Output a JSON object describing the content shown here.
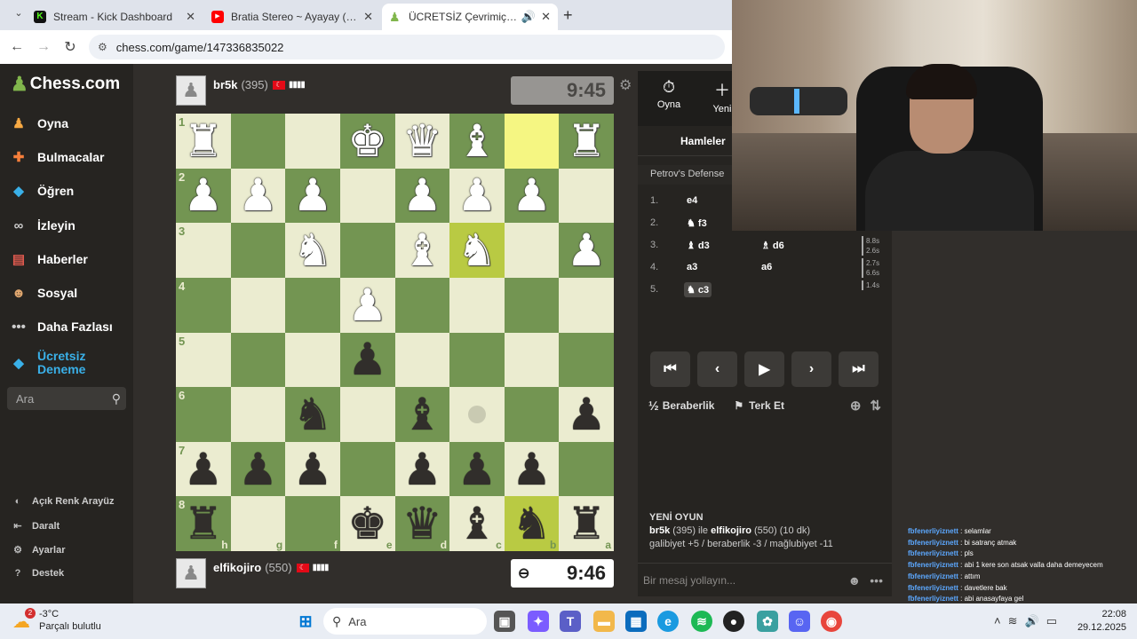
{
  "browser": {
    "tabs": [
      {
        "title": "Stream - Kick Dashboard",
        "favicon_color": "#53fc18",
        "favicon": "K"
      },
      {
        "title": "Bratia Stereo ~ Ayayay (Lyrics) ft",
        "favicon_color": "#ff0000",
        "favicon": "▶"
      },
      {
        "title": "ÜCRETSİZ Çevrimiçi Satranç",
        "favicon_color": "#81b64c",
        "favicon": "♟"
      }
    ],
    "url": "chess.com/game/147336835022"
  },
  "sidebar": {
    "logo": "Chess.com",
    "items": [
      {
        "label": "Oyna",
        "icon": "play-pawn-icon"
      },
      {
        "label": "Bulmacalar",
        "icon": "puzzle-icon"
      },
      {
        "label": "Öğren",
        "icon": "learn-icon"
      },
      {
        "label": "İzleyin",
        "icon": "binoculars-icon"
      },
      {
        "label": "Haberler",
        "icon": "news-icon"
      },
      {
        "label": "Sosyal",
        "icon": "social-icon"
      },
      {
        "label": "Daha Fazlası",
        "icon": "more-icon"
      },
      {
        "label": "Ücretsiz Deneme",
        "icon": "diamond-icon"
      }
    ],
    "search_placeholder": "Ara",
    "footer": [
      {
        "label": "Açık Renk Arayüz",
        "icon": "contrast-icon"
      },
      {
        "label": "Daralt",
        "icon": "collapse-icon"
      },
      {
        "label": "Ayarlar",
        "icon": "gear-icon"
      },
      {
        "label": "Destek",
        "icon": "help-icon"
      }
    ]
  },
  "game": {
    "top_player": {
      "name": "br5k",
      "rating": "(395)",
      "clock": "9:45"
    },
    "bottom_player": {
      "name": "elfikojiro",
      "rating": "(550)",
      "clock": "9:46"
    },
    "ranks": [
      "1",
      "2",
      "3",
      "4",
      "5",
      "6",
      "7",
      "8"
    ],
    "files": [
      "h",
      "g",
      "f",
      "e",
      "d",
      "c",
      "b",
      "a"
    ],
    "board": [
      [
        "wR",
        "",
        "",
        "wK",
        "wQ",
        "wB",
        "",
        "wR"
      ],
      [
        "wP",
        "wP",
        "wP",
        "",
        "wP",
        "wP",
        "wP",
        ""
      ],
      [
        "",
        "",
        "wN",
        "",
        "wB",
        "wN",
        "",
        "wP"
      ],
      [
        "",
        "",
        "",
        "wP",
        "",
        "",
        "",
        ""
      ],
      [
        "",
        "",
        "",
        "bP",
        "",
        "",
        "",
        ""
      ],
      [
        "",
        "",
        "bN",
        "",
        "bB",
        "",
        "",
        "bP"
      ],
      [
        "bP",
        "bP",
        "bP",
        "",
        "bP",
        "bP",
        "bP",
        ""
      ],
      [
        "bR",
        "",
        "",
        "bK",
        "bQ",
        "bB",
        "bN",
        "bR"
      ]
    ],
    "highlights": [
      [
        0,
        6
      ],
      [
        2,
        5
      ],
      [
        7,
        6
      ]
    ],
    "move_hint": [
      5,
      5
    ]
  },
  "panel": {
    "tabs": [
      {
        "label": "Oyna",
        "icon": "stopwatch-icon"
      },
      {
        "label": "Yeni",
        "icon": "new-game-icon"
      }
    ],
    "moves_header": "Hamleler",
    "opening": "Petrov's Defense",
    "moves": [
      {
        "n": "1.",
        "w": "e4",
        "b": "",
        "wp": "",
        "bp": "",
        "t1": "",
        "t2": ""
      },
      {
        "n": "2.",
        "w": "f3",
        "b": "",
        "wp": "♞",
        "bp": "",
        "t1": "",
        "t2": ""
      },
      {
        "n": "3.",
        "w": "d3",
        "b": "d6",
        "wp": "♝",
        "bp": "♗",
        "t1": "8.8s",
        "t2": "2.6s"
      },
      {
        "n": "4.",
        "w": "a3",
        "b": "a6",
        "wp": "",
        "bp": "",
        "t1": "2.7s",
        "t2": "6.6s"
      },
      {
        "n": "5.",
        "w": "c3",
        "b": "",
        "wp": "♞",
        "bp": "",
        "t1": "1.4s",
        "t2": ""
      }
    ],
    "actions": {
      "draw": "Beraberlik",
      "resign": "Terk Et",
      "half": "½"
    },
    "new_game": {
      "heading": "YENİ OYUN",
      "line1_a": "br5k",
      "line1_b": " (395) ile ",
      "line1_c": "elfikojiro",
      "line1_d": " (550) (10 dk)",
      "line2": "galibiyet +5 / beraberlik -3 / mağlubiyet -11"
    },
    "chat_placeholder": "Bir mesaj yollayın..."
  },
  "stream_chat": [
    {
      "user": "fbfenerliyiznett",
      "msg": ": selamlar"
    },
    {
      "user": "fbfenerliyiznett",
      "msg": ": bi satranç atmak"
    },
    {
      "user": "fbfenerliyiznett",
      "msg": ": pls"
    },
    {
      "user": "fbfenerliyiznett",
      "msg": ": abi 1 kere son atsak valla daha demeyecem"
    },
    {
      "user": "fbfenerliyiznett",
      "msg": ": attım"
    },
    {
      "user": "fbfenerliyiznett",
      "msg": ": davetlere bak"
    },
    {
      "user": "fbfenerliyiznett",
      "msg": ": abi anasayfaya gel"
    }
  ],
  "taskbar": {
    "temp": "-3°C",
    "weather": "Parçalı bulutlu",
    "weather_badge": "2",
    "search": "Ara",
    "time": "22:08",
    "date": "29.12.2025"
  }
}
